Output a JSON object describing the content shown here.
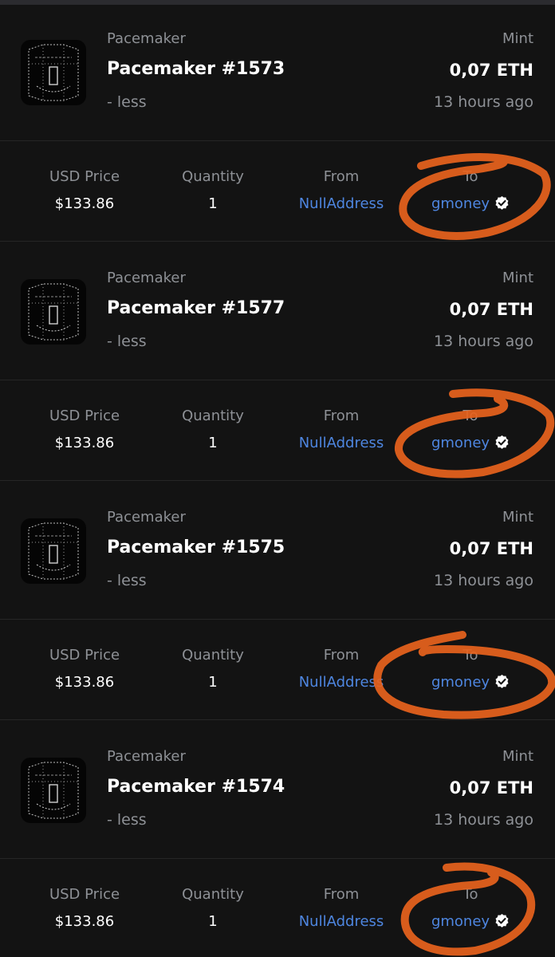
{
  "labels": {
    "usd_price": "USD Price",
    "quantity": "Quantity",
    "from": "From",
    "to": "To"
  },
  "colors": {
    "background": "#131313",
    "muted_text": "#8e9196",
    "link": "#4e86e0",
    "annotation": "#e8631d"
  },
  "icons": [
    "nft-thumbnail",
    "verified-badge-icon"
  ],
  "transactions": [
    {
      "collection": "Pacemaker",
      "name": "Pacemaker #1573",
      "less": "- less",
      "event": "Mint",
      "price": "0,07 ETH",
      "time": "13 hours ago",
      "usd_price": "$133.86",
      "quantity": "1",
      "from": "NullAddress",
      "to": "gmoney"
    },
    {
      "collection": "Pacemaker",
      "name": "Pacemaker #1577",
      "less": "- less",
      "event": "Mint",
      "price": "0,07 ETH",
      "time": "13 hours ago",
      "usd_price": "$133.86",
      "quantity": "1",
      "from": "NullAddress",
      "to": "gmoney"
    },
    {
      "collection": "Pacemaker",
      "name": "Pacemaker #1575",
      "less": "- less",
      "event": "Mint",
      "price": "0,07 ETH",
      "time": "13 hours ago",
      "usd_price": "$133.86",
      "quantity": "1",
      "from": "NullAddress",
      "to": "gmoney"
    },
    {
      "collection": "Pacemaker",
      "name": "Pacemaker #1574",
      "less": "- less",
      "event": "Mint",
      "price": "0,07 ETH",
      "time": "13 hours ago",
      "usd_price": "$133.86",
      "quantity": "1",
      "from": "NullAddress",
      "to": "gmoney"
    }
  ]
}
